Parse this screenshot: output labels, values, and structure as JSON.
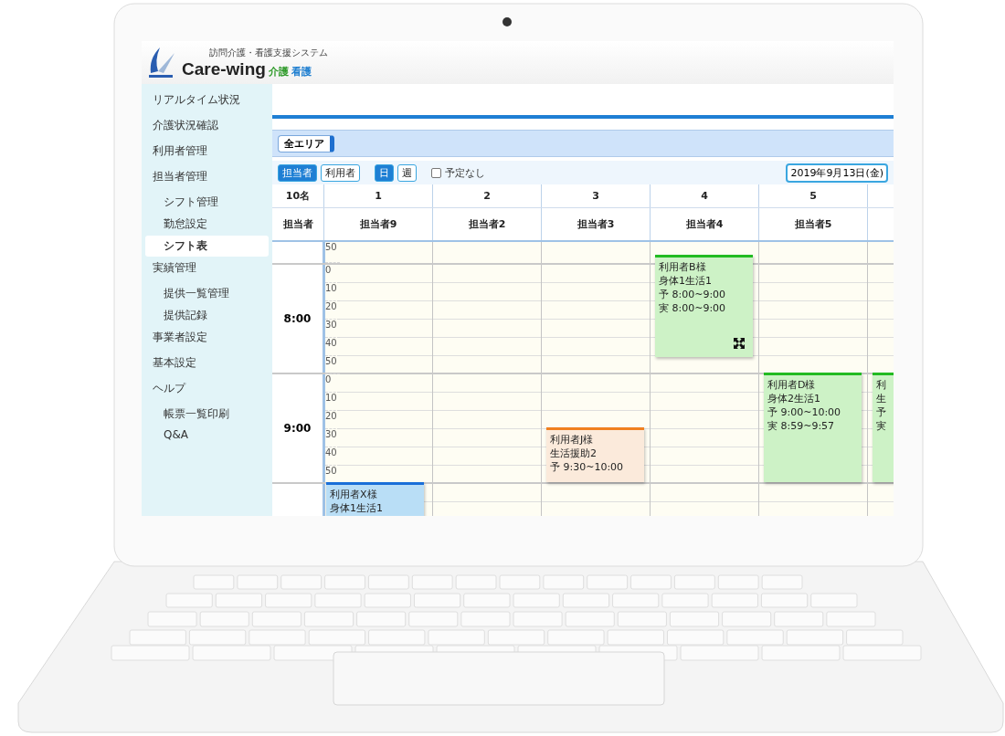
{
  "logo": {
    "subtitle": "訪問介護・看護支援システム",
    "brand": "Care-wing",
    "tags": [
      {
        "text": "介護",
        "color": "#2f9a2a"
      },
      {
        "text": "看護",
        "color": "#1f7fd0"
      }
    ]
  },
  "sidebar": {
    "items": [
      {
        "label": "リアルタイム状況",
        "selected": false
      },
      {
        "label": "介護状況確認",
        "selected": false
      },
      {
        "label": "利用者管理",
        "selected": false
      },
      {
        "label": "担当者管理",
        "selected": false,
        "children": [
          {
            "label": "シフト管理",
            "selected": false
          },
          {
            "label": "勤怠設定",
            "selected": false
          },
          {
            "label": "シフト表",
            "selected": true
          }
        ]
      },
      {
        "label": "実績管理",
        "selected": false,
        "children": [
          {
            "label": "提供一覧管理",
            "selected": false
          },
          {
            "label": "提供記録",
            "selected": false
          }
        ]
      },
      {
        "label": "事業者設定",
        "selected": false
      },
      {
        "label": "基本設定",
        "selected": false
      },
      {
        "label": "ヘルプ",
        "selected": false,
        "children": [
          {
            "label": "帳票一覧印刷",
            "selected": false
          },
          {
            "label": "Q&A",
            "selected": false
          }
        ]
      }
    ]
  },
  "area_select": {
    "value": "全エリア"
  },
  "toolbar": {
    "view_buttons": [
      {
        "label": "担当者",
        "selected": true
      },
      {
        "label": "利用者",
        "selected": false
      }
    ],
    "range_buttons": [
      {
        "label": "日",
        "selected": true
      },
      {
        "label": "週",
        "selected": false
      }
    ],
    "no_plan": {
      "label": "予定なし",
      "checked": false
    },
    "date": "2019年9月13日(金)"
  },
  "schedule": {
    "count": "10名",
    "staff_label": "担当者",
    "columns": [
      {
        "number": "1",
        "staff": "担当者9",
        "events": [
          {
            "color": "#1a6fd8",
            "expand": false,
            "lines": [
              "利用者X様",
              "身体1生活1"
            ]
          }
        ]
      },
      {
        "number": "2",
        "staff": "担当者2"
      },
      {
        "number": "3",
        "staff": "担当者3",
        "events": [
          {
            "color": "#f08020",
            "expand": false,
            "lines": [
              "利用者J様",
              "生活援助2",
              "予 9:30~10:00"
            ]
          }
        ]
      },
      {
        "number": "4",
        "staff": "担当者4",
        "events": [
          {
            "color": "#22bb22",
            "expand": true,
            "lines": [
              "利用者B様",
              "身体1生活1",
              "予 8:00~9:00",
              "実 8:00~9:00"
            ]
          }
        ]
      },
      {
        "number": "5",
        "staff": "担当者5",
        "events": [
          {
            "color": "#22bb22",
            "expand": false,
            "lines": [
              "利用者D様",
              "身体2生活1",
              "予 9:00~10:00",
              "実 8:59~9:57"
            ]
          }
        ]
      },
      {
        "events": [
          {
            "color": "#22bb22",
            "expand": false,
            "lines": [
              "利",
              "生",
              "予",
              "実"
            ]
          }
        ]
      }
    ],
    "top_minutes": [
      "50"
    ],
    "hours": [
      {
        "label": "8:00",
        "minutes": [
          "0",
          "10",
          "20",
          "30",
          "40",
          "50"
        ]
      },
      {
        "label": "9:00",
        "minutes": [
          "0",
          "10",
          "20",
          "30",
          "40",
          "50"
        ]
      }
    ]
  }
}
